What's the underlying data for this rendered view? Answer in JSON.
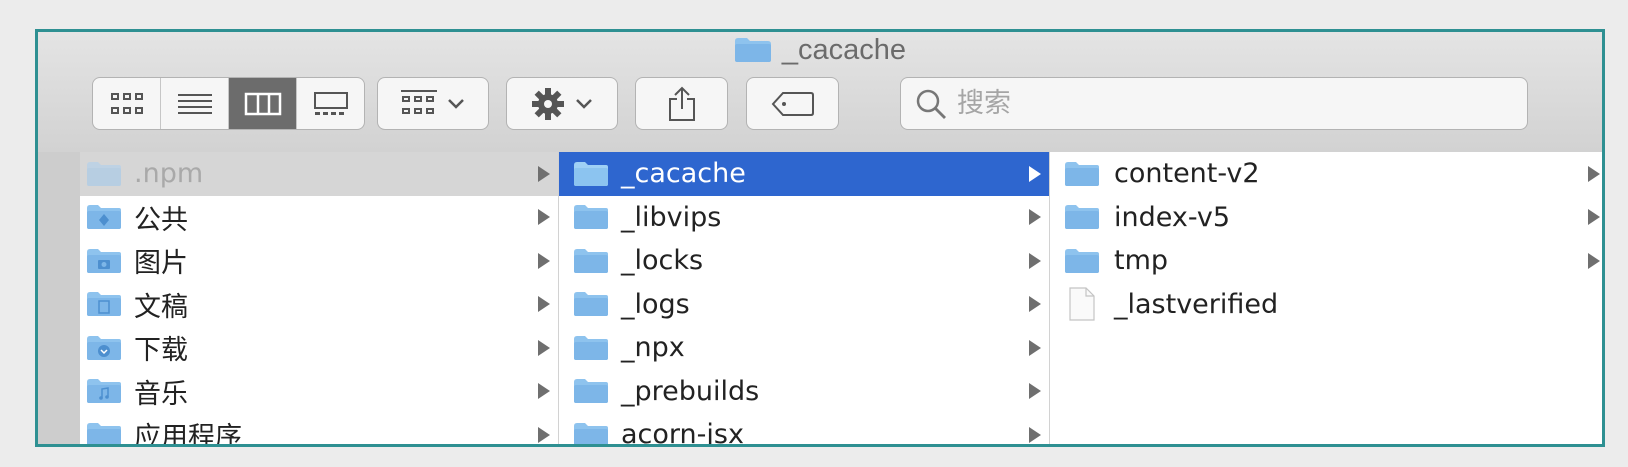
{
  "window": {
    "title": "_cacache"
  },
  "toolbar": {
    "view_modes": [
      {
        "name": "icon-view",
        "icon": "grid-icon",
        "active": false
      },
      {
        "name": "list-view",
        "icon": "list-icon",
        "active": false
      },
      {
        "name": "column-view",
        "icon": "columns-icon",
        "active": true
      },
      {
        "name": "gallery-view",
        "icon": "gallery-icon",
        "active": false
      }
    ],
    "search": {
      "placeholder": "搜索"
    }
  },
  "columns": [
    {
      "items": [
        {
          "label": ".npm",
          "state": "dimmed",
          "icon": "folder-icon",
          "arrow": true
        },
        {
          "label": "公共",
          "icon": "public-folder-icon",
          "arrow": true
        },
        {
          "label": "图片",
          "icon": "pictures-folder-icon",
          "arrow": true
        },
        {
          "label": "文稿",
          "icon": "documents-folder-icon",
          "arrow": true
        },
        {
          "label": "下载",
          "icon": "downloads-folder-icon",
          "arrow": true
        },
        {
          "label": "音乐",
          "icon": "music-folder-icon",
          "arrow": true
        },
        {
          "label": "应用程序",
          "icon": "applications-folder-icon",
          "arrow": true
        }
      ]
    },
    {
      "items": [
        {
          "label": "_cacache",
          "state": "selected",
          "icon": "folder-icon",
          "arrow": true
        },
        {
          "label": "_libvips",
          "icon": "folder-icon",
          "arrow": true
        },
        {
          "label": "_locks",
          "icon": "folder-icon",
          "arrow": true
        },
        {
          "label": "_logs",
          "icon": "folder-icon",
          "arrow": true
        },
        {
          "label": "_npx",
          "icon": "folder-icon",
          "arrow": true
        },
        {
          "label": "_prebuilds",
          "icon": "folder-icon",
          "arrow": true
        },
        {
          "label": "acorn-jsx",
          "icon": "folder-icon",
          "arrow": true
        }
      ]
    },
    {
      "items": [
        {
          "label": "content-v2",
          "icon": "folder-icon",
          "arrow": true
        },
        {
          "label": "index-v5",
          "icon": "folder-icon",
          "arrow": true
        },
        {
          "label": "tmp",
          "icon": "folder-icon",
          "arrow": true
        },
        {
          "label": "_lastverified",
          "icon": "document-icon",
          "arrow": false
        }
      ]
    }
  ],
  "colors": {
    "selection": "#2e66cf",
    "folder": "#7db6e8",
    "window_border": "#2e9092"
  }
}
